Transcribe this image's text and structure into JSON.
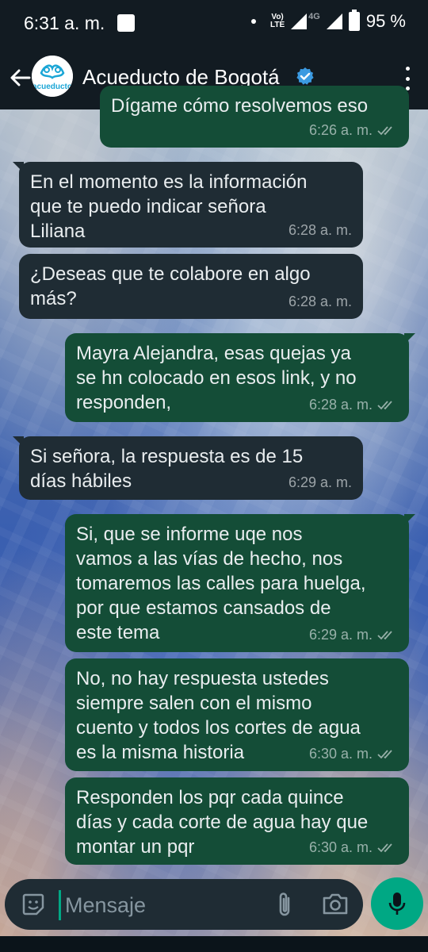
{
  "status_bar": {
    "time": "6:31 a. m.",
    "volte_top": "Vo)",
    "volte_bottom": "LTE",
    "network": "4G",
    "battery": "95 %"
  },
  "header": {
    "contact_name": "Acueducto de Bogotá",
    "avatar_text": "acueducto",
    "verified_color": "#3b9ae1"
  },
  "messages": [
    {
      "dir": "out",
      "text": "Dígame cómo resolvemos eso",
      "time": "6:26 a. m."
    },
    {
      "dir": "in",
      "text": "En el momento es la información\nque te puedo indicar señora\nLiliana",
      "time": "6:28 a. m."
    },
    {
      "dir": "in",
      "text": "¿Deseas que te colabore en algo\nmás?",
      "time": "6:28 a. m."
    },
    {
      "dir": "out",
      "text": "Mayra Alejandra, esas quejas ya\nse hn colocado en esos link, y no\nresponden,",
      "time": "6:28 a. m."
    },
    {
      "dir": "in",
      "text": "Si señora, la respuesta es de 15\ndías hábiles",
      "time": "6:29 a. m."
    },
    {
      "dir": "out",
      "text": "Si, que se informe uqe nos\nvamos a las vías de hecho, nos\ntomaremos las calles para huelga,\npor que estamos cansados de\neste tema",
      "time": "6:29 a. m."
    },
    {
      "dir": "out",
      "text": "No, no hay respuesta ustedes\nsiempre salen con el mismo\ncuento y todos los cortes de agua\nes la misma historia",
      "time": "6:30 a. m."
    },
    {
      "dir": "out",
      "text": "Responden los pqr cada quince\ndías y cada corte de agua hay que\nmontar un pqr",
      "time": "6:30 a. m."
    }
  ],
  "composer": {
    "placeholder": "Mensaje"
  },
  "colors": {
    "outgoing_bubble": "#144d37",
    "incoming_bubble": "#1f2c34",
    "accent": "#00a884"
  }
}
